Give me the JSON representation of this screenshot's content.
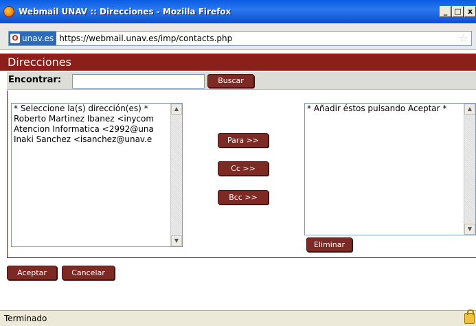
{
  "window": {
    "title": "Webmail UNAV :: Direcciones - Mozilla Firefox",
    "controls": [
      "_",
      "□",
      "x"
    ]
  },
  "urlbar": {
    "site": "unav.es",
    "url": "https://webmail.unav.es/imp/contacts.php"
  },
  "page": {
    "header": "Direcciones",
    "search": {
      "label": "Encontrar:",
      "value": "",
      "button": "Buscar"
    },
    "source_list": [
      "* Seleccione la(s) dirección(es) *",
      "Roberto Martinez Ibanez <inycom",
      "Atencion Informatica <2992@una",
      "Inaki Sanchez <isanchez@unav.e"
    ],
    "dest_list": [
      "* Añadir éstos pulsando Aceptar *"
    ],
    "buttons": {
      "to": "Para >>",
      "cc": "Cc >>",
      "bcc": "Bcc >>",
      "remove": "Eliminar",
      "accept": "Aceptar",
      "cancel": "Cancelar"
    }
  },
  "statusbar": {
    "text": "Terminado"
  },
  "colors": {
    "brand": "#8b1f1a",
    "button": "#7e2a24",
    "titlebar": "#0a5ce4"
  }
}
